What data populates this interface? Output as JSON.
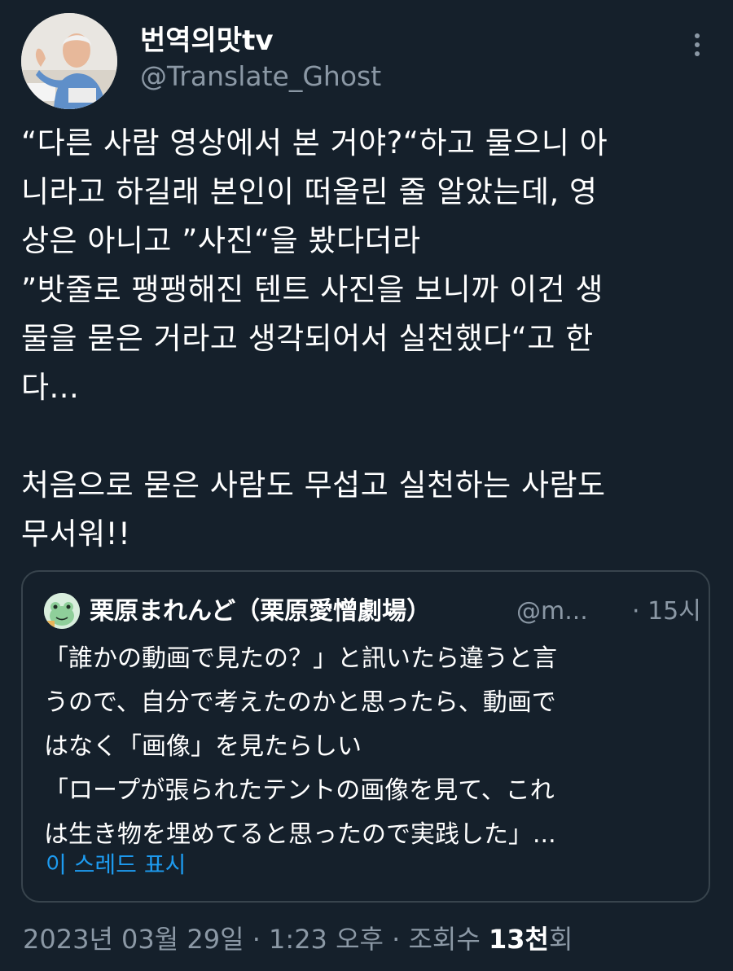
{
  "author": {
    "name": "번역의맛tv",
    "handle": "@Translate_Ghost"
  },
  "tweet": {
    "text": "“다른 사람 영상에서 본 거야?“하고 물으니 아\n니라고 하길래 본인이 떠올린 줄 알았는데, 영\n상은 아니고 ”사진“을 봤다더라\n”밧줄로 팽팽해진 텐트 사진을 보니까 이건 생\n물을 묻은 거라고 생각되어서 실천했다“고 한\n다...\n\n처음으로 묻은 사람도 무섭고 실천하는 사람도\n무서워!!"
  },
  "quote": {
    "name": "栗原まれんど（栗原愛憎劇場）",
    "handle": "@m...",
    "time": "· 15시",
    "text": "「誰かの動画で見たの？」と訊いたら違うと言\nうので、自分で考えたのかと思ったら、動画で\nはなく「画像」を見たらしい\n「ロープが張られたテントの画像を見て、これ\nは生き物を埋めてると思ったので実践した」...",
    "show_thread": "이 스레드 표시"
  },
  "meta": {
    "datetime": "2023년 03월 29일 · 1:23 오후 · 조회수 ",
    "views": "13천",
    "views_suffix": "회"
  },
  "colors": {
    "background": "#15202b",
    "text": "#ffffff",
    "secondary": "#8b98a5",
    "link": "#1d9bf0",
    "border": "#38444d"
  }
}
